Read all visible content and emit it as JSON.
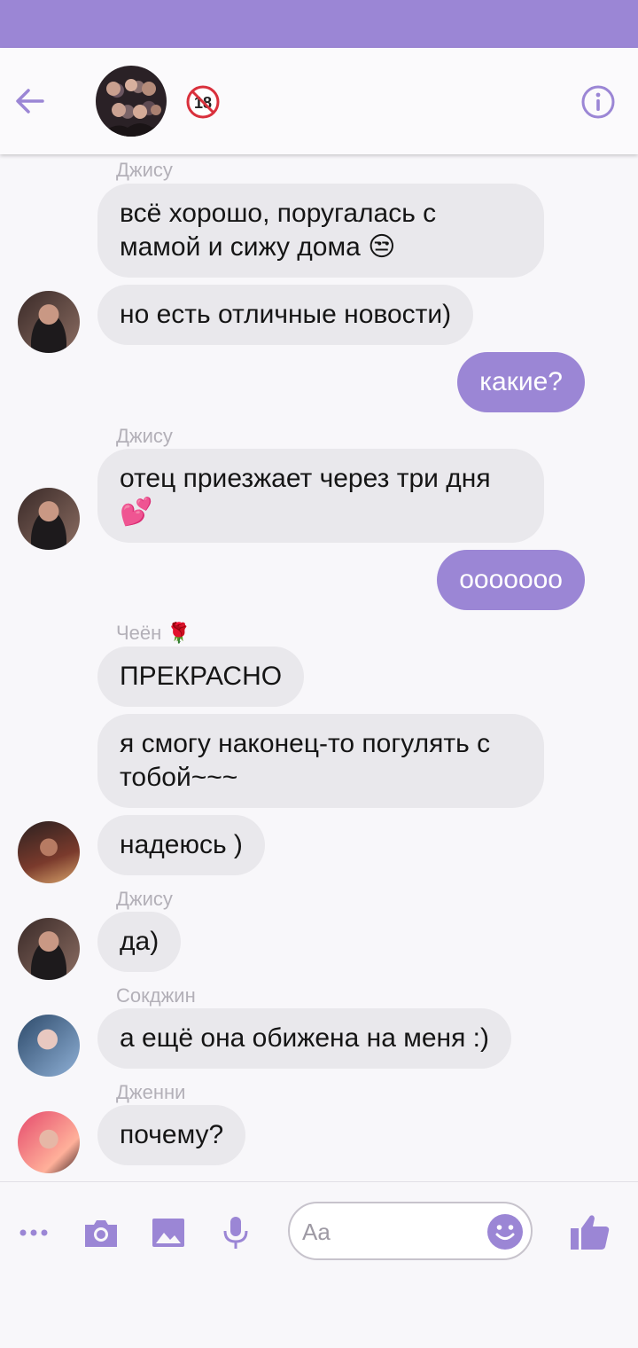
{
  "colors": {
    "accent": "#9b86d5",
    "incoming_bubble": "#e9e8ec",
    "sender_label": "#b3b0b8"
  },
  "header": {
    "back_icon": "arrow-left-icon",
    "group_avatar": "group-photo",
    "badge": "18+ badge",
    "info_icon": "info-icon"
  },
  "messages": {
    "m1_sender": "Джису",
    "m1_text": "всё хорошо, поругалась с\nмамой и сижу дома 😒",
    "m2_text": "но есть отличные новости)",
    "m3_text": "какие?",
    "m4_sender": "Джису",
    "m4_text": "отец приезжает через три дня\n💕",
    "m5_text": "ooooooo",
    "m6_sender": "Чеён 🌹",
    "m6_text": "ПРЕКРАСНО",
    "m7_text": "я смогу наконец-то погулять с\nтобой~~~",
    "m8_text": "надеюсь )",
    "m9_sender": "Джису",
    "m9_text": "да)",
    "m10_sender": "Сокджин",
    "m10_text": "а ещё она обижена на меня :)",
    "m11_sender": "Дженни",
    "m11_text": "почему?"
  },
  "composer": {
    "placeholder": "Aa",
    "icons": [
      "more-icon",
      "camera-icon",
      "image-icon",
      "mic-icon",
      "emoji-icon",
      "thumbs-up-icon"
    ]
  }
}
